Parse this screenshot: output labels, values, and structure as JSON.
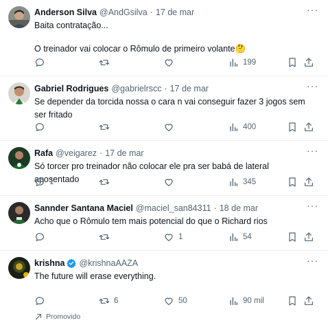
{
  "tweets": [
    {
      "name": "Anderson Silva",
      "handle": "@AndGsilva",
      "date": "17 de mar",
      "lines": [
        "Baita contratação...",
        "",
        "O treinador vai colocar o Rômulo de primeiro volante🤔"
      ],
      "reply_count": "",
      "retweet_count": "",
      "like_count": "",
      "views": "199"
    },
    {
      "name": "Gabriel Rodrigues",
      "handle": "@gabrielrscc",
      "date": "17 de mar",
      "lines": [
        "Se depender da torcida nossa o cara n vai conseguir fazer 3 jogos sem ser fritado"
      ],
      "reply_count": "",
      "retweet_count": "",
      "like_count": "",
      "views": "400"
    },
    {
      "name": "Rafa",
      "handle": "@veigarez",
      "date": "17 de mar",
      "lines": [
        "Só torcer pro treinador não colocar ele pra ser babá de lateral aposentado"
      ],
      "reply_count": "1",
      "retweet_count": "",
      "like_count": "",
      "views": "345"
    },
    {
      "name": "Sannder Santana Maciel",
      "handle": "@maciel_san84311",
      "date": "18 de mar",
      "lines": [
        "Acho que o Rômulo tem mais potencial do que o Richard rios"
      ],
      "reply_count": "",
      "retweet_count": "",
      "like_count": "1",
      "views": "54"
    },
    {
      "name": "krishna",
      "handle": "@krishnaAAZA",
      "date": "",
      "verified": true,
      "lines": [
        "The future will erase everything."
      ],
      "reply_count": "",
      "retweet_count": "6",
      "like_count": "50",
      "views": "90 mil",
      "promoted_label": "Promovido"
    }
  ],
  "more_glyph": "···",
  "date_separator": "·",
  "colors": {
    "text": "#0f1419",
    "secondary": "#536471",
    "divider": "#eff3f4",
    "verified": "#1d9bf0"
  }
}
